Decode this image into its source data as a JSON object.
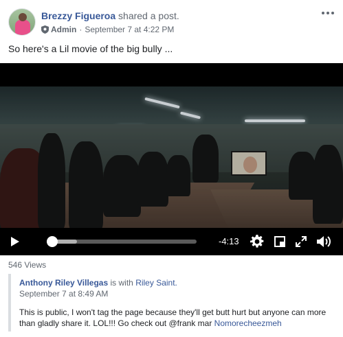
{
  "post": {
    "author": "Brezzy Figueroa",
    "action": "shared a post.",
    "role": "Admin",
    "separator": "·",
    "timestamp": "September 7 at 4:22 PM",
    "text": "So here's a Lil movie of the big bully ..."
  },
  "video": {
    "time_remaining": "-4:13",
    "progress_fraction": 0.0,
    "buffered_fraction": 0.2,
    "views": "546 Views"
  },
  "shared_post": {
    "author": "Anthony Riley Villegas",
    "with_text": "is with",
    "tagged": "Riley Saint.",
    "timestamp": "September 7 at 8:49 AM",
    "body": "This is public, I won't tag the page because they'll get butt hurt but anyone can more than gladly share it. LOL!!! Go check out @frank mar ",
    "body_link": "Nomorecheezmeh"
  },
  "icons": [
    "shield-icon",
    "more-options-icon",
    "play-icon",
    "settings-icon",
    "miniplayer-icon",
    "fullscreen-icon",
    "volume-icon"
  ],
  "colors": {
    "link": "#385898",
    "meta": "#606770",
    "text": "#1c1e21",
    "video_bg": "#000000"
  }
}
